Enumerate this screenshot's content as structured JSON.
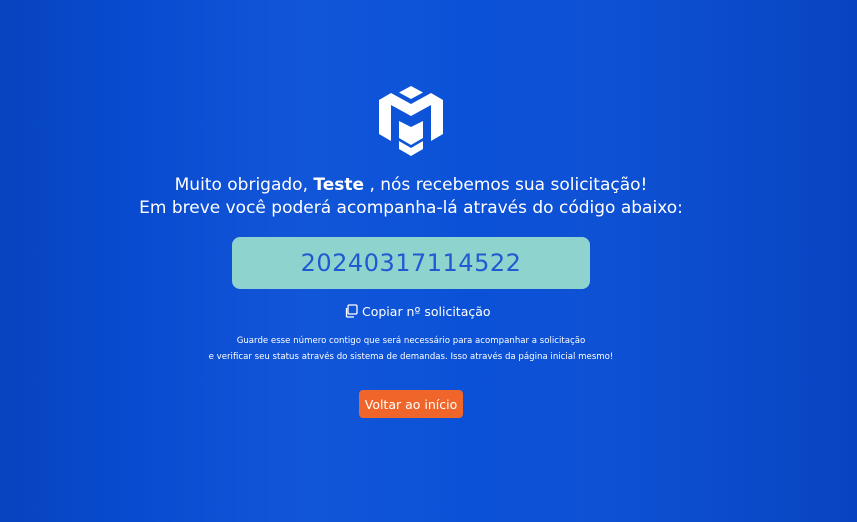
{
  "brand": {
    "logo_icon": "m-cube-logo-icon",
    "background_color": "#0a4fd6",
    "accent_color": "#f0652a",
    "code_box_color": "#8fd3cf"
  },
  "message": {
    "line1_prefix": "Muito obrigado, ",
    "user_name": "Teste",
    "line1_suffix": " , nós recebemos sua solicitação!",
    "line2": "Em breve você poderá acompanha-lá através do código abaixo:"
  },
  "request": {
    "code": "20240317114522",
    "copy_label": "Copiar nº solicitação",
    "copy_icon": "copy-icon"
  },
  "note": {
    "line1": "Guarde esse número contigo que será necessário para acompanhar a solicitação",
    "line2": "e verificar seu status através do sistema de demandas. Isso através da página inicial mesmo!"
  },
  "actions": {
    "back_label": "Voltar ao início"
  }
}
